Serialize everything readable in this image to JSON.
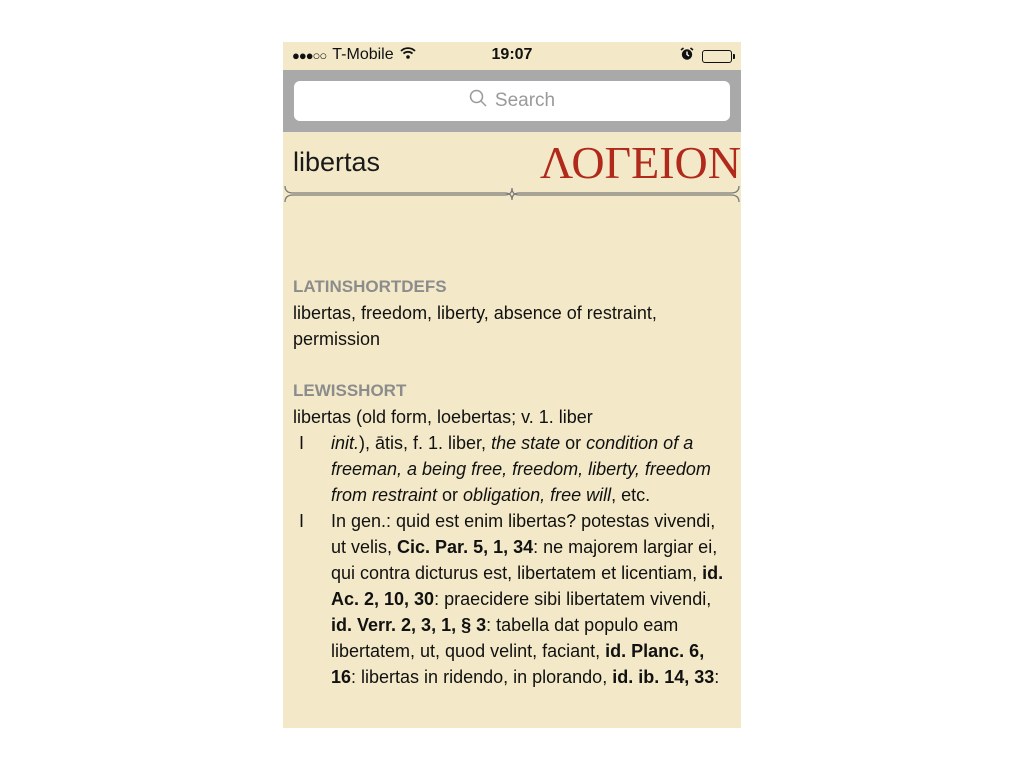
{
  "status": {
    "carrier": "T-Mobile",
    "signal": "●●●○○",
    "time": "19:07"
  },
  "search": {
    "placeholder": "Search"
  },
  "header": {
    "entry": "libertas",
    "logo": "ΛΟΓΕΙΟΝ"
  },
  "colors": {
    "paper": "#f3e9c8",
    "logo_red": "#b0291b",
    "section_gray": "#8c8c8c"
  },
  "sections": {
    "shortdefs": {
      "title": "LATINSHORTDEFS",
      "text": "libertas, freedom, liberty, absence of restraint, permission"
    },
    "lewis": {
      "title": "LEWISSHORT",
      "headword": "libertas (old form, loebertas; v. 1. liber",
      "sense1_num": "I",
      "sense1": {
        "a": "init.",
        "b": "), ātis, f. 1. liber, ",
        "c": "the state",
        "d": " or ",
        "e": "condition of a freeman, a being free, freedom, liberty, freedom from restraint",
        "f": " or ",
        "g": "obligation, free will",
        "h": ", etc."
      },
      "sense2_num": "I",
      "sense2": {
        "a": "In gen.: quid est enim libertas? potestas vivendi, ut velis, ",
        "b": "Cic. Par. 5, 1, 34",
        "c": ": ne majorem largiar ei, qui contra dicturus est, libertatem et licentiam, ",
        "d": "id. Ac. 2, 10, 30",
        "e": ": praecidere sibi libertatem vivendi, ",
        "f": "id. Verr. 2, 3, 1, § 3",
        "g": ": tabella dat populo eam libertatem, ut, quod velint, faciant, ",
        "h": "id. Planc. 6, 16",
        "i": ": libertas in ridendo, in plorando, ",
        "j": "id. ib. 14, 33",
        "k": ":"
      }
    }
  }
}
